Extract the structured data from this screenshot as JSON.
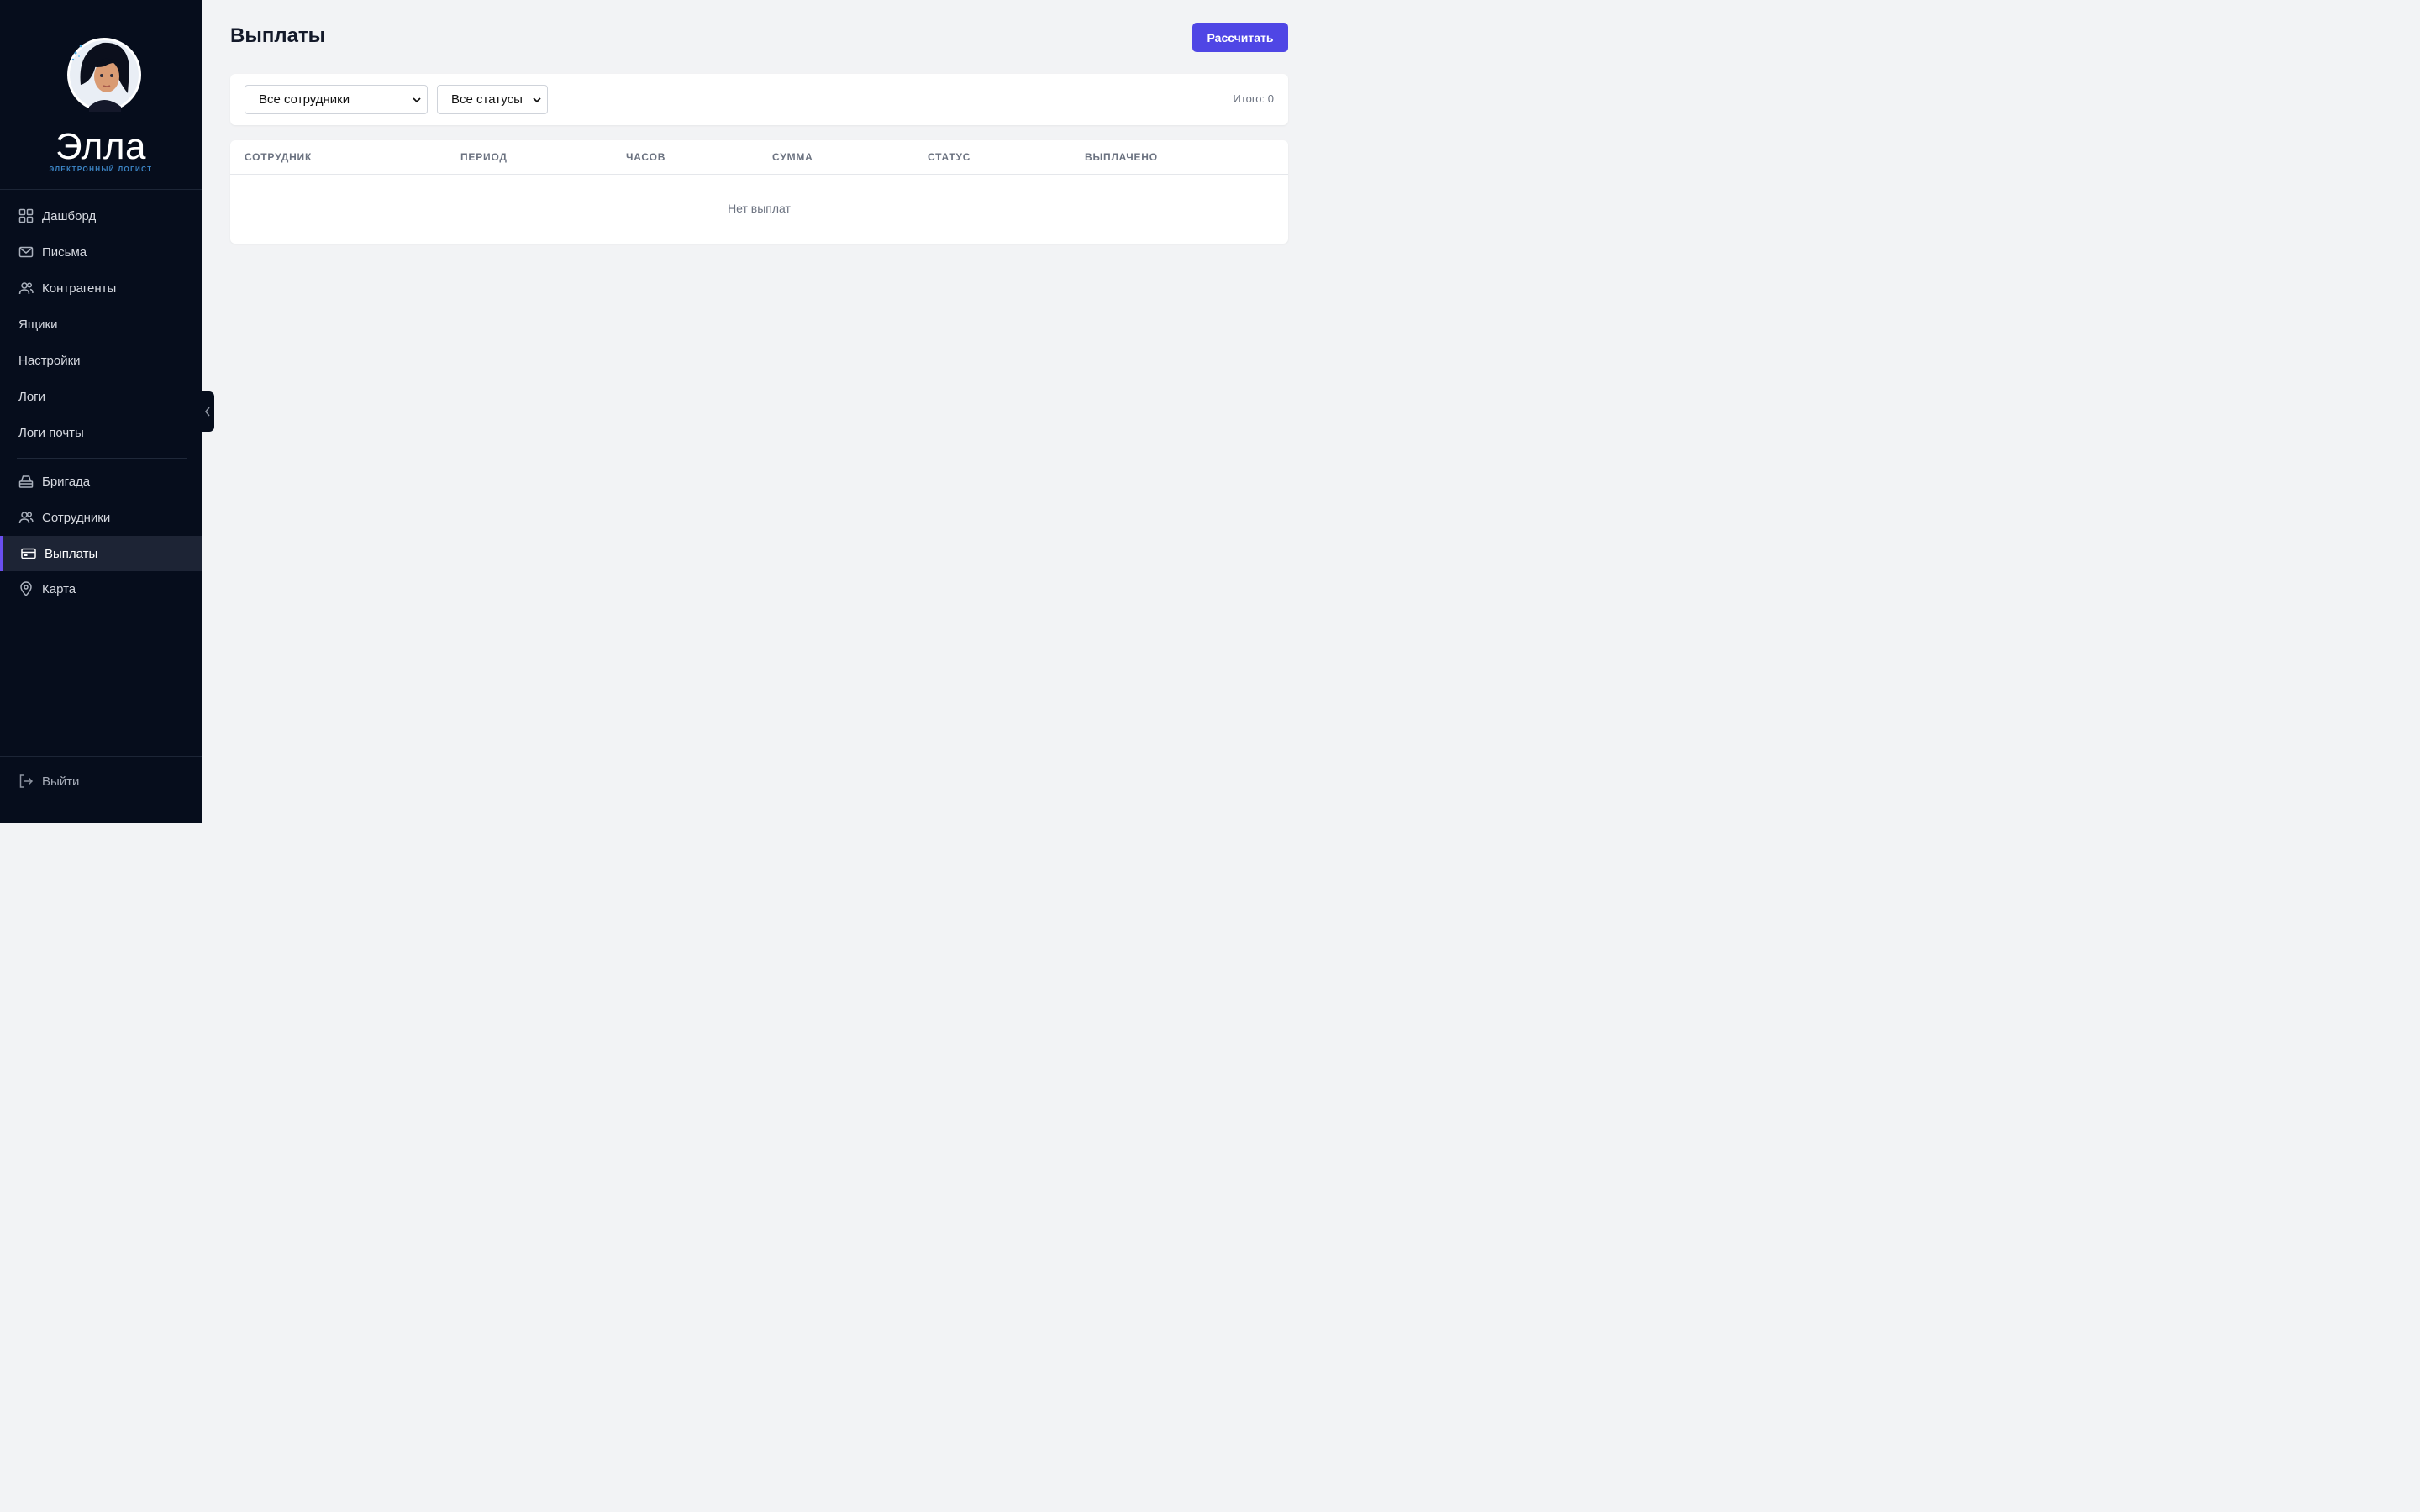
{
  "brand": {
    "name": "Элла",
    "subtitle": "ЭЛЕКТРОННЫЙ ЛОГИСТ"
  },
  "sidebar": {
    "items": [
      {
        "label": "Дашборд",
        "icon": "grid-icon"
      },
      {
        "label": "Письма",
        "icon": "mail-icon"
      },
      {
        "label": "Контрагенты",
        "icon": "users-icon"
      },
      {
        "label": "Ящики",
        "icon": null
      },
      {
        "label": "Настройки",
        "icon": null
      },
      {
        "label": "Логи",
        "icon": null
      },
      {
        "label": "Логи почты",
        "icon": null
      },
      {
        "label": "Бригада",
        "icon": "briefcase-icon"
      },
      {
        "label": "Сотрудники",
        "icon": "users-icon"
      },
      {
        "label": "Выплаты",
        "icon": "credit-card-icon",
        "active": true
      },
      {
        "label": "Карта",
        "icon": "map-pin-icon"
      }
    ],
    "logout_label": "Выйти"
  },
  "header": {
    "title": "Выплаты",
    "action_label": "Рассчитать"
  },
  "filters": {
    "employee_select": "Все сотрудники",
    "status_select": "Все статусы",
    "total": "Итого: 0"
  },
  "table": {
    "columns": [
      "СОТРУДНИК",
      "ПЕРИОД",
      "ЧАСОВ",
      "СУММА",
      "СТАТУС",
      "ВЫПЛАЧЕНО"
    ],
    "empty_text": "Нет выплат"
  },
  "colors": {
    "sidebar_bg": "#060d1c",
    "accent": "#4f46e5",
    "active_bar": "#6a4ff0",
    "page_bg": "#f2f3f5"
  }
}
